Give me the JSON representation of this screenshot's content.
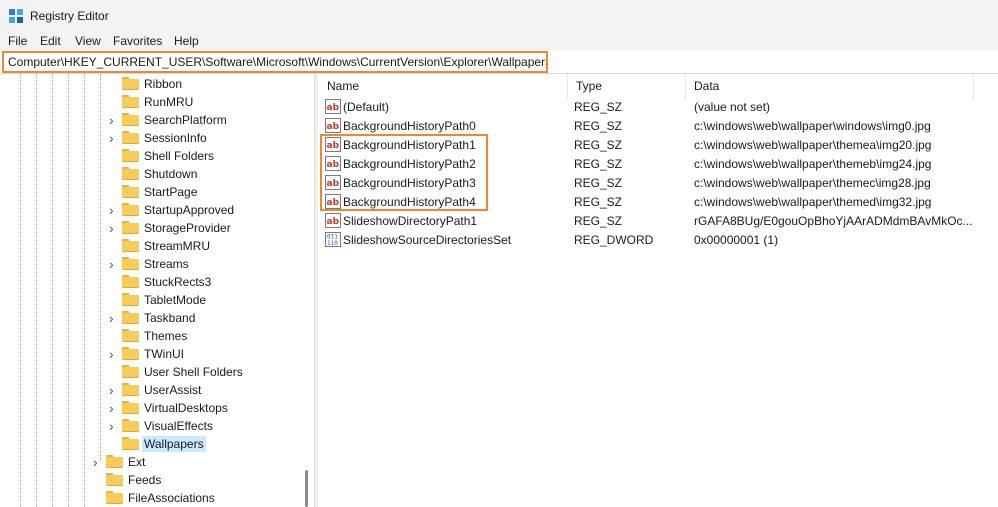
{
  "window": {
    "title": "Registry Editor",
    "icon": "registry-editor-icon"
  },
  "menu": [
    "File",
    "Edit",
    "View",
    "Favorites",
    "Help"
  ],
  "address": "Computer\\HKEY_CURRENT_USER\\Software\\Microsoft\\Windows\\CurrentVersion\\Explorer\\Wallpapers",
  "tree": {
    "items": [
      {
        "label": "Ribbon",
        "expandable": false,
        "level": 2,
        "selected": false
      },
      {
        "label": "RunMRU",
        "expandable": false,
        "level": 2,
        "selected": false
      },
      {
        "label": "SearchPlatform",
        "expandable": true,
        "level": 2,
        "selected": false
      },
      {
        "label": "SessionInfo",
        "expandable": true,
        "level": 2,
        "selected": false
      },
      {
        "label": "Shell Folders",
        "expandable": false,
        "level": 2,
        "selected": false
      },
      {
        "label": "Shutdown",
        "expandable": false,
        "level": 2,
        "selected": false
      },
      {
        "label": "StartPage",
        "expandable": false,
        "level": 2,
        "selected": false
      },
      {
        "label": "StartupApproved",
        "expandable": true,
        "level": 2,
        "selected": false
      },
      {
        "label": "StorageProvider",
        "expandable": true,
        "level": 2,
        "selected": false
      },
      {
        "label": "StreamMRU",
        "expandable": false,
        "level": 2,
        "selected": false
      },
      {
        "label": "Streams",
        "expandable": true,
        "level": 2,
        "selected": false
      },
      {
        "label": "StuckRects3",
        "expandable": false,
        "level": 2,
        "selected": false
      },
      {
        "label": "TabletMode",
        "expandable": false,
        "level": 2,
        "selected": false
      },
      {
        "label": "Taskband",
        "expandable": true,
        "level": 2,
        "selected": false
      },
      {
        "label": "Themes",
        "expandable": false,
        "level": 2,
        "selected": false
      },
      {
        "label": "TWinUI",
        "expandable": true,
        "level": 2,
        "selected": false
      },
      {
        "label": "User Shell Folders",
        "expandable": false,
        "level": 2,
        "selected": false
      },
      {
        "label": "UserAssist",
        "expandable": true,
        "level": 2,
        "selected": false
      },
      {
        "label": "VirtualDesktops",
        "expandable": true,
        "level": 2,
        "selected": false
      },
      {
        "label": "VisualEffects",
        "expandable": true,
        "level": 2,
        "selected": false
      },
      {
        "label": "Wallpapers",
        "expandable": false,
        "level": 2,
        "selected": true
      },
      {
        "label": "Ext",
        "expandable": true,
        "level": 1,
        "selected": false
      },
      {
        "label": "Feeds",
        "expandable": false,
        "level": 1,
        "selected": false
      },
      {
        "label": "FileAssociations",
        "expandable": false,
        "level": 1,
        "selected": false
      }
    ]
  },
  "list": {
    "columns": {
      "name": "Name",
      "type": "Type",
      "data": "Data"
    },
    "rows": [
      {
        "icon": "string-value-icon",
        "name": "(Default)",
        "type": "REG_SZ",
        "data": "(value not set)"
      },
      {
        "icon": "string-value-icon",
        "name": "BackgroundHistoryPath0",
        "type": "REG_SZ",
        "data": "c:\\windows\\web\\wallpaper\\windows\\img0.jpg"
      },
      {
        "icon": "string-value-icon",
        "name": "BackgroundHistoryPath1",
        "type": "REG_SZ",
        "data": "c:\\windows\\web\\wallpaper\\themea\\img20.jpg"
      },
      {
        "icon": "string-value-icon",
        "name": "BackgroundHistoryPath2",
        "type": "REG_SZ",
        "data": "c:\\windows\\web\\wallpaper\\themeb\\img24.jpg"
      },
      {
        "icon": "string-value-icon",
        "name": "BackgroundHistoryPath3",
        "type": "REG_SZ",
        "data": "c:\\windows\\web\\wallpaper\\themec\\img28.jpg"
      },
      {
        "icon": "string-value-icon",
        "name": "BackgroundHistoryPath4",
        "type": "REG_SZ",
        "data": "c:\\windows\\web\\wallpaper\\themed\\img32.jpg"
      },
      {
        "icon": "string-value-icon",
        "name": "SlideshowDirectoryPath1",
        "type": "REG_SZ",
        "data": "rGAFA8BUg/E0gouOpBhoYjAArADMdmBAvMkOc..."
      },
      {
        "icon": "binary-value-icon",
        "name": "SlideshowSourceDirectoriesSet",
        "type": "REG_DWORD",
        "data": "0x00000001 (1)"
      }
    ]
  },
  "colors": {
    "highlight": "#f0862f",
    "selection": "#cce8ff",
    "folder": "#f6cd5c"
  }
}
